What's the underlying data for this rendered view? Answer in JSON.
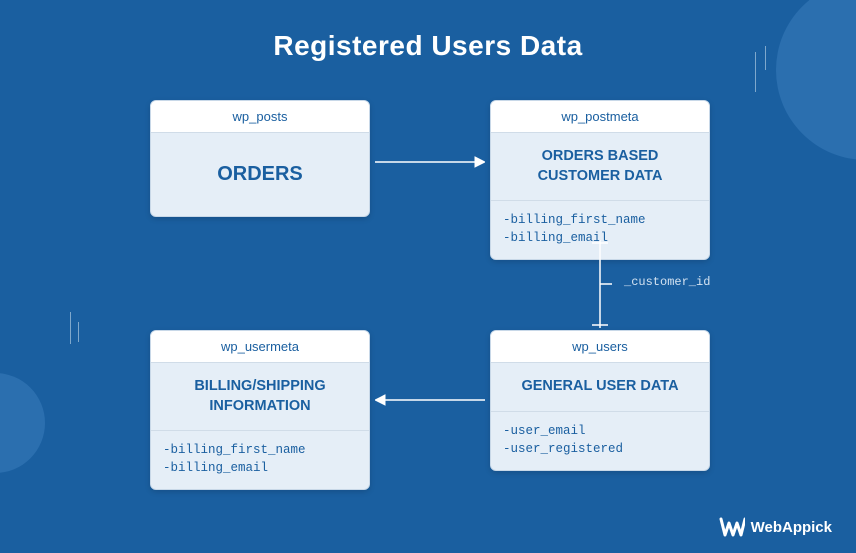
{
  "title": "Registered Users Data",
  "cards": {
    "posts": {
      "header": "wp_posts",
      "body": "ORDERS"
    },
    "postmeta": {
      "header": "wp_postmeta",
      "body": "ORDERS BASED CUSTOMER DATA",
      "field1": "-billing_first_name",
      "field2": "-billing_email"
    },
    "usermeta": {
      "header": "wp_usermeta",
      "body": "BILLING/SHIPPING INFORMATION",
      "field1": "-billing_first_name",
      "field2": "-billing_email"
    },
    "users": {
      "header": "wp_users",
      "body": "GENERAL USER DATA",
      "field1": "-user_email",
      "field2": "-user_registered"
    }
  },
  "relation_label": "_customer_id",
  "brand": "WebAppick"
}
